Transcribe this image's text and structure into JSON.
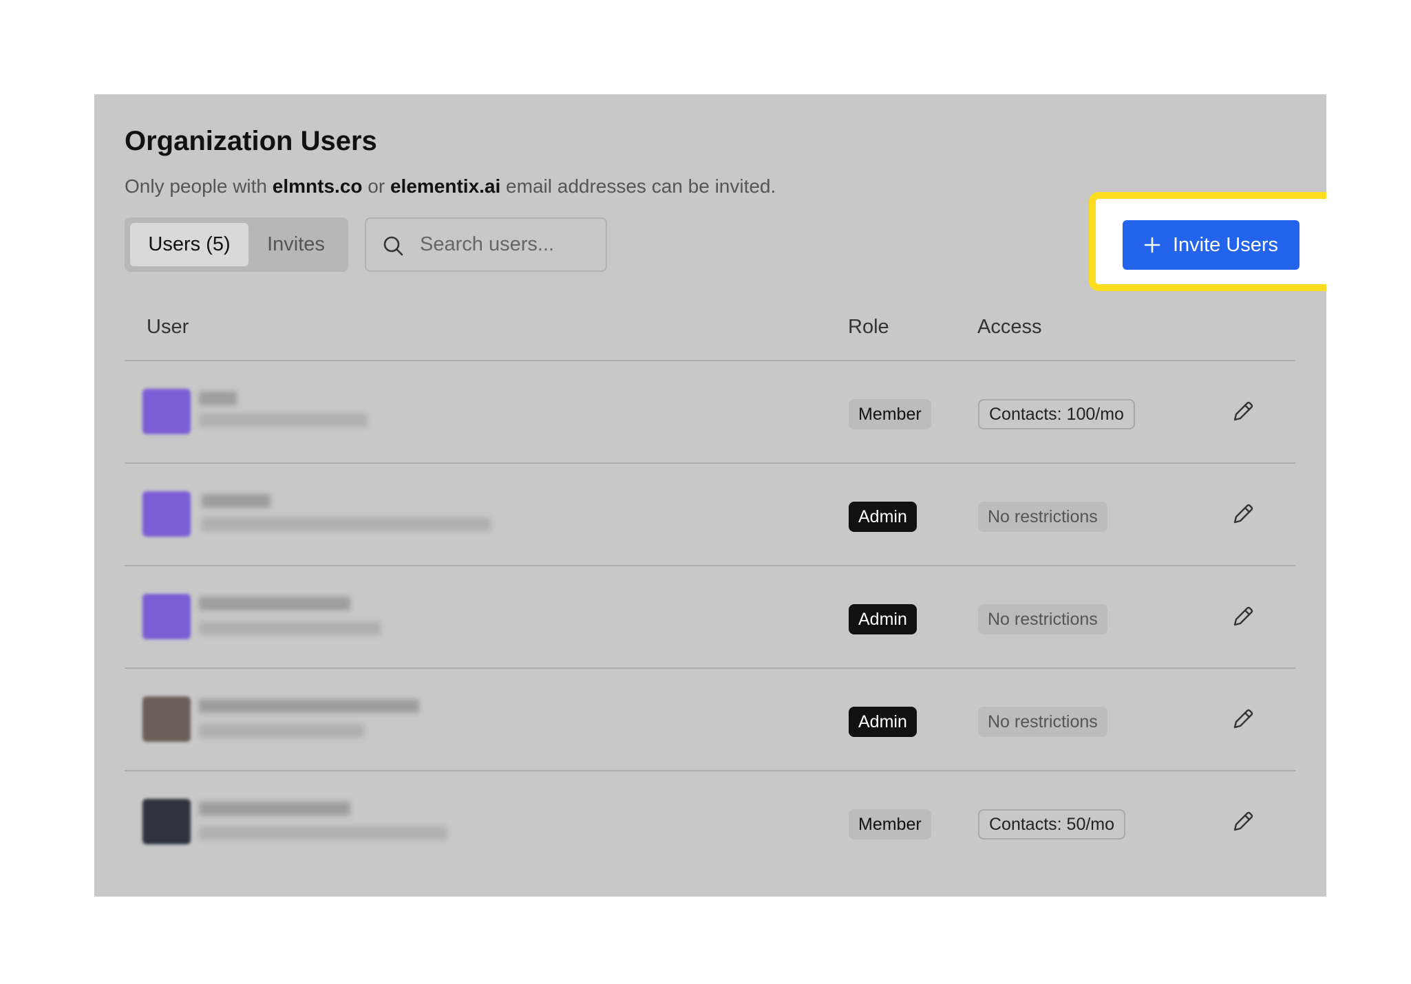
{
  "page": {
    "title": "Organization Users",
    "subtitle": {
      "prefix": "Only people with ",
      "domain1": "elmnts.co",
      "middle": " or ",
      "domain2": "elementix.ai",
      "suffix": " email addresses can be invited."
    }
  },
  "tabs": [
    {
      "label": "Users (5)",
      "active": true
    },
    {
      "label": "Invites",
      "active": false
    }
  ],
  "search": {
    "placeholder": "Search users...",
    "icon": "search-icon"
  },
  "invite_button": {
    "label": "Invite Users",
    "icon": "plus-icon",
    "color": "#2463eb"
  },
  "highlight_color": "#fbdc1f",
  "table": {
    "columns": [
      "User",
      "Role",
      "Access"
    ],
    "rows": [
      {
        "role": "Member",
        "access": "Contacts: 100/mo"
      },
      {
        "role": "Admin",
        "access": "No restrictions"
      },
      {
        "role": "Admin",
        "access": "No restrictions"
      },
      {
        "role": "Admin",
        "access": "No restrictions"
      },
      {
        "role": "Member",
        "access": "Contacts: 50/mo"
      }
    ]
  }
}
